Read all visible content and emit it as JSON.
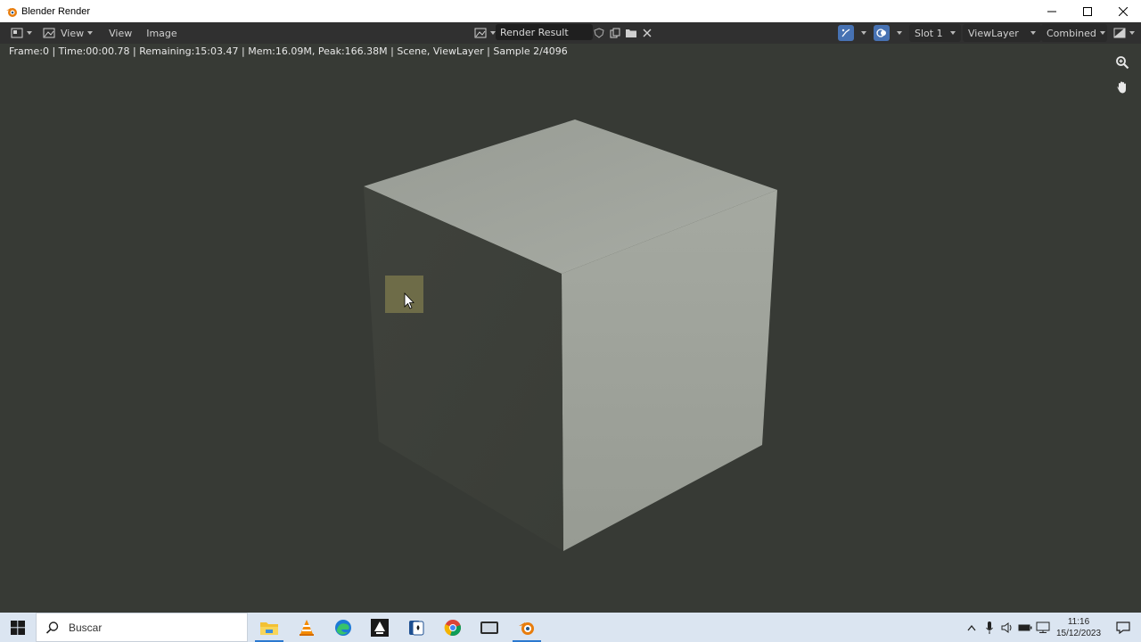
{
  "window": {
    "title": "Blender Render"
  },
  "header": {
    "menu_view": "View",
    "menu_view2": "View",
    "menu_image": "Image",
    "image_name": "Render Result",
    "slot": "Slot 1",
    "view_layer": "ViewLayer",
    "pass": "Combined"
  },
  "status_line": "Frame:0 | Time:00:00.78 | Remaining:15:03.47 | Mem:16.09M, Peak:166.38M | Scene, ViewLayer | Sample 2/4096",
  "taskbar": {
    "search_placeholder": "Buscar",
    "time": "11:16",
    "date": "15/12/2023"
  },
  "colors": {
    "viewport_bg": "#373a35",
    "header_bg": "#303030",
    "accent_blue": "#4772b3",
    "cube_top": "#9ea39c",
    "cube_right": "#a3a89f",
    "cube_left": "#3e413b",
    "highlight_tile": "#6e6c48"
  },
  "icons": [
    "blender-icon",
    "image-editor-icon",
    "image-icon",
    "shield-icon",
    "duplicate-icon",
    "folder-icon",
    "close-icon",
    "gizmo-icon",
    "overlay-icon",
    "display-channels-icon",
    "zoom-icon",
    "hand-icon",
    "windows-start-icon",
    "search-icon",
    "file-explorer-icon",
    "vlc-icon",
    "edge-icon",
    "inkscape-icon",
    "solitaire-icon",
    "chrome-icon",
    "screen-capture-icon",
    "blender-taskbar-icon",
    "chevron-up-icon",
    "microphone-icon",
    "volume-icon",
    "battery-icon",
    "network-icon",
    "notifications-icon"
  ]
}
